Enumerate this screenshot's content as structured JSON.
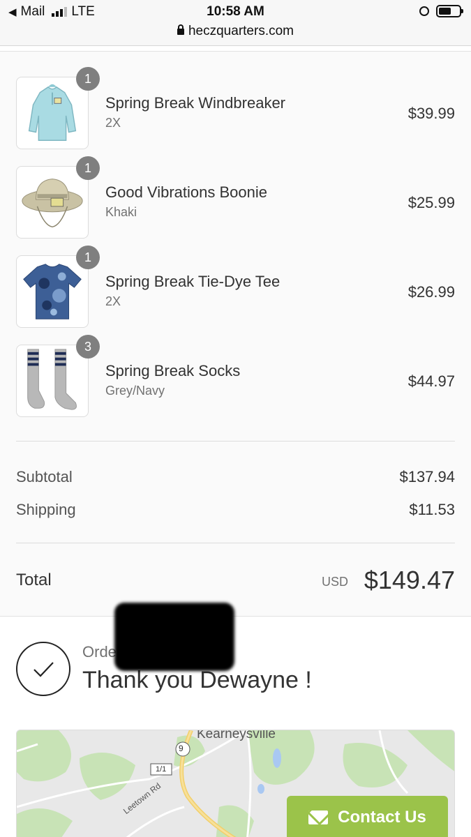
{
  "status_bar": {
    "back_app": "Mail",
    "network": "LTE",
    "time": "10:58 AM"
  },
  "browser": {
    "url": "heczquarters.com"
  },
  "cart": {
    "items": [
      {
        "quantity": "1",
        "name": "Spring Break Windbreaker",
        "variant": "2X",
        "price": "$39.99",
        "image": "windbreaker-image"
      },
      {
        "quantity": "1",
        "name": "Good Vibrations Boonie",
        "variant": "Khaki",
        "price": "$25.99",
        "image": "boonie-hat-image"
      },
      {
        "quantity": "1",
        "name": "Spring Break Tie-Dye Tee",
        "variant": "2X",
        "price": "$26.99",
        "image": "tie-dye-tee-image"
      },
      {
        "quantity": "3",
        "name": "Spring Break Socks",
        "variant": "Grey/Navy",
        "price": "$44.97",
        "image": "socks-image"
      }
    ]
  },
  "totals": {
    "subtotal_label": "Subtotal",
    "subtotal_value": "$137.94",
    "shipping_label": "Shipping",
    "shipping_value": "$11.53",
    "total_label": "Total",
    "currency": "USD",
    "total_value": "$149.47"
  },
  "confirmation": {
    "order_label": "Order",
    "thank_you": "Thank you Dewayne !"
  },
  "map": {
    "town": "Kearneysville",
    "route_badge": "9",
    "road_shield": "1/1",
    "road_name": "Leetown Rd"
  },
  "contact": {
    "label": "Contact Us"
  },
  "colors": {
    "accent": "#9bc34a",
    "qty_badge": "#7f7f7f"
  }
}
